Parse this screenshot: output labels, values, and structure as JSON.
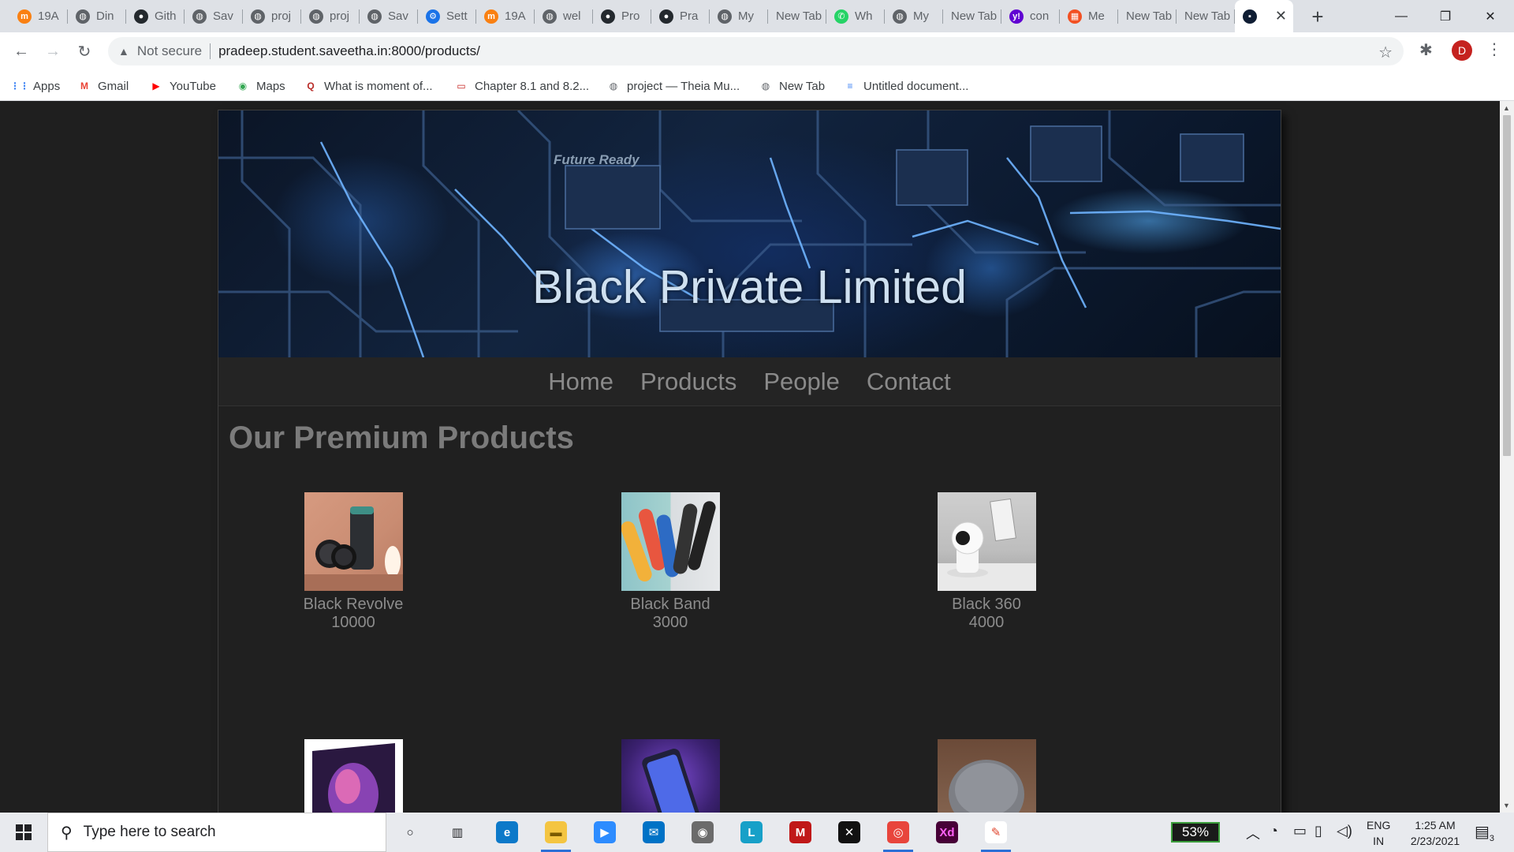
{
  "browser": {
    "tabs": [
      {
        "title": "19A",
        "icon": "moodle-icon",
        "color": "#f98012"
      },
      {
        "title": "Din",
        "icon": "globe-icon",
        "color": "#5f6368"
      },
      {
        "title": "Gith",
        "icon": "github-icon",
        "color": "#24292e"
      },
      {
        "title": "Sav",
        "icon": "globe-icon",
        "color": "#5f6368"
      },
      {
        "title": "proj",
        "icon": "globe-icon",
        "color": "#5f6368"
      },
      {
        "title": "proj",
        "icon": "globe-icon",
        "color": "#5f6368"
      },
      {
        "title": "Sav",
        "icon": "globe-icon",
        "color": "#5f6368"
      },
      {
        "title": "Sett",
        "icon": "gear-icon",
        "color": "#1a73e8"
      },
      {
        "title": "19A",
        "icon": "moodle-icon",
        "color": "#f98012"
      },
      {
        "title": "wel",
        "icon": "globe-icon",
        "color": "#5f6368"
      },
      {
        "title": "Pro",
        "icon": "github-icon",
        "color": "#24292e"
      },
      {
        "title": "Pra",
        "icon": "github-icon",
        "color": "#24292e"
      },
      {
        "title": "My",
        "icon": "globe-icon",
        "color": "#5f6368"
      },
      {
        "title": "New Tab",
        "icon": "",
        "color": ""
      },
      {
        "title": "Wh",
        "icon": "whatsapp-icon",
        "color": "#25d366"
      },
      {
        "title": "My",
        "icon": "globe-icon",
        "color": "#5f6368"
      },
      {
        "title": "New Tab",
        "icon": "",
        "color": ""
      },
      {
        "title": "con",
        "icon": "yahoo-icon",
        "color": "#6001d2"
      },
      {
        "title": "Me",
        "icon": "microsoft-icon",
        "color": "#f25022"
      },
      {
        "title": "New Tab",
        "icon": "",
        "color": ""
      },
      {
        "title": "New Tab",
        "icon": "",
        "color": ""
      },
      {
        "title": "",
        "icon": "site-icon",
        "color": "#0f1d33",
        "active": true
      }
    ],
    "close_glyph": "✕",
    "new_tab_glyph": "+",
    "window_controls": {
      "minimize": "—",
      "restore": "❐",
      "close": "✕"
    },
    "address": {
      "security_label": "Not secure",
      "url": "pradeep.student.saveetha.in:8000/products/"
    },
    "profile_initial": "D",
    "bookmarks": [
      {
        "label": "Apps",
        "icon": "apps-grid-icon",
        "color": "#4285f4"
      },
      {
        "label": "Gmail",
        "icon": "gmail-icon",
        "color": "#ea4335"
      },
      {
        "label": "YouTube",
        "icon": "youtube-icon",
        "color": "#ff0000"
      },
      {
        "label": "Maps",
        "icon": "maps-icon",
        "color": "#34a853"
      },
      {
        "label": "What is moment of...",
        "icon": "quora-icon",
        "color": "#b92b27"
      },
      {
        "label": "Chapter 8.1 and 8.2...",
        "icon": "slides-icon",
        "color": "#c5221f"
      },
      {
        "label": "project — Theia Mu...",
        "icon": "globe-icon",
        "color": "#5f6368"
      },
      {
        "label": "New Tab",
        "icon": "globe-icon",
        "color": "#5f6368"
      },
      {
        "label": "Untitled document...",
        "icon": "docs-icon",
        "color": "#4285f4"
      }
    ]
  },
  "site": {
    "banner_tagline": "Future Ready",
    "title": "Black Private Limited",
    "nav": [
      "Home",
      "Products",
      "People",
      "Contact"
    ],
    "heading": "Our Premium Products",
    "products": [
      {
        "name": "Black Revolve",
        "price": "10000",
        "image": "smartwatch-speaker"
      },
      {
        "name": "Black Band",
        "price": "3000",
        "image": "fitness-bands"
      },
      {
        "name": "Black 360",
        "price": "4000",
        "image": "security-camera"
      },
      {
        "name": "",
        "price": "",
        "image": "tv"
      },
      {
        "name": "",
        "price": "",
        "image": "smartphone"
      },
      {
        "name": "",
        "price": "",
        "image": "smart-speaker"
      }
    ]
  },
  "taskbar": {
    "search_placeholder": "Type here to search",
    "apps": [
      "cortana-icon",
      "task-view-icon",
      "edge-icon",
      "file-explorer-icon",
      "zoom-icon",
      "mail-icon",
      "camera-icon",
      "l-app-icon",
      "mcafee-icon",
      "xbox-icon",
      "chrome-icon",
      "adobe-xd-icon",
      "paint-icon"
    ],
    "battery": "53%",
    "language_line1": "ENG",
    "language_line2": "IN",
    "time": "1:25 AM",
    "date": "2/23/2021",
    "notification_count": "3"
  }
}
